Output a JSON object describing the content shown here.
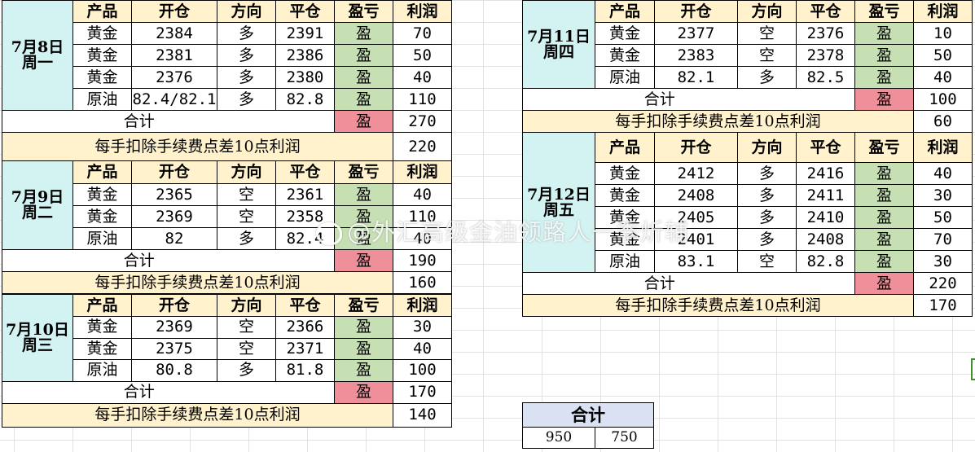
{
  "columns": {
    "product": "产品",
    "open": "开仓",
    "direction": "方向",
    "close": "平仓",
    "pnl": "盈亏",
    "profit": "利润"
  },
  "total_label": "合计",
  "fee_label": "每手扣除手续费点差10点利润",
  "days": [
    {
      "date": "7月8日",
      "weekday": "周一",
      "trades": [
        {
          "product": "黄金",
          "open": "2384",
          "direction": "多",
          "close": "2391",
          "pnl": "盈",
          "profit": "70"
        },
        {
          "product": "黄金",
          "open": "2381",
          "direction": "多",
          "close": "2386",
          "pnl": "盈",
          "profit": "50"
        },
        {
          "product": "黄金",
          "open": "2376",
          "direction": "多",
          "close": "2380",
          "pnl": "盈",
          "profit": "40"
        },
        {
          "product": "原油",
          "open": "82.4/82.1",
          "direction": "多",
          "close": "82.8",
          "pnl": "盈",
          "profit": "110"
        }
      ],
      "total_pnl": "盈",
      "total_profit": "270",
      "net_profit": "220"
    },
    {
      "date": "7月9日",
      "weekday": "周二",
      "trades": [
        {
          "product": "黄金",
          "open": "2365",
          "direction": "空",
          "close": "2361",
          "pnl": "盈",
          "profit": "40"
        },
        {
          "product": "黄金",
          "open": "2369",
          "direction": "空",
          "close": "2358",
          "pnl": "盈",
          "profit": "110"
        },
        {
          "product": "原油",
          "open": "82",
          "direction": "多",
          "close": "82.4",
          "pnl": "盈",
          "profit": "40"
        }
      ],
      "total_pnl": "盈",
      "total_profit": "190",
      "net_profit": "160"
    },
    {
      "date": "7月10日",
      "weekday": "周三",
      "trades": [
        {
          "product": "黄金",
          "open": "2369",
          "direction": "空",
          "close": "2366",
          "pnl": "盈",
          "profit": "30"
        },
        {
          "product": "黄金",
          "open": "2375",
          "direction": "空",
          "close": "2371",
          "pnl": "盈",
          "profit": "40"
        },
        {
          "product": "原油",
          "open": "80.8",
          "direction": "多",
          "close": "81.8",
          "pnl": "盈",
          "profit": "100"
        }
      ],
      "total_pnl": "盈",
      "total_profit": "170",
      "net_profit": "140"
    },
    {
      "date": "7月11日",
      "weekday": "周四",
      "trades": [
        {
          "product": "黄金",
          "open": "2377",
          "direction": "空",
          "close": "2376",
          "pnl": "盈",
          "profit": "10"
        },
        {
          "product": "黄金",
          "open": "2383",
          "direction": "空",
          "close": "2378",
          "pnl": "盈",
          "profit": "50"
        },
        {
          "product": "原油",
          "open": "82.1",
          "direction": "多",
          "close": "82.5",
          "pnl": "盈",
          "profit": "40"
        }
      ],
      "total_pnl": "盈",
      "total_profit": "100",
      "net_profit": "60"
    },
    {
      "date": "7月12日",
      "weekday": "周五",
      "trades": [
        {
          "product": "黄金",
          "open": "2412",
          "direction": "多",
          "close": "2416",
          "pnl": "盈",
          "profit": "40"
        },
        {
          "product": "黄金",
          "open": "2408",
          "direction": "多",
          "close": "2411",
          "pnl": "盈",
          "profit": "30"
        },
        {
          "product": "黄金",
          "open": "2405",
          "direction": "多",
          "close": "2410",
          "pnl": "盈",
          "profit": "50"
        },
        {
          "product": "黄金",
          "open": "2401",
          "direction": "多",
          "close": "2408",
          "pnl": "盈",
          "profit": "70"
        },
        {
          "product": "原油",
          "open": "83.1",
          "direction": "空",
          "close": "82.8",
          "pnl": "盈",
          "profit": "30"
        }
      ],
      "total_pnl": "盈",
      "total_profit": "220",
      "net_profit": "170"
    }
  ],
  "summary": {
    "title": "合计",
    "gross_total": "950",
    "net_total": "750"
  },
  "watermark": "@外汇高级金油领路人一季炘辅",
  "colors": {
    "header_bg": "#fff2cc",
    "date_bg": "#d3f3f3",
    "win_bg": "#c6e0b4",
    "total_pnl_bg": "#ef8f9a",
    "summary_header_bg": "#d9e1f2",
    "selection_border": "#3f8f2a"
  }
}
